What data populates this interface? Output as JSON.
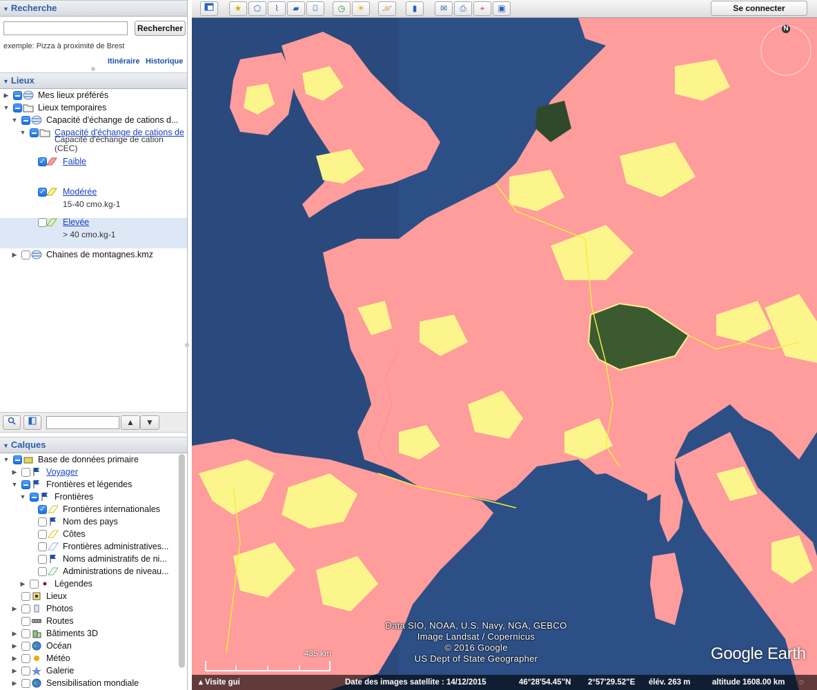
{
  "search": {
    "header": "Recherche",
    "placeholder": "",
    "button": "Rechercher",
    "example": "exemple: Pizza à proximité de Brest",
    "links": [
      "Itinéraire",
      "Historique"
    ]
  },
  "places": {
    "header": "Lieux",
    "items": [
      {
        "label": "Mes lieux préférés"
      },
      {
        "label": "Lieux temporaires"
      },
      {
        "label": "Capacité d'échange de cations d..."
      },
      {
        "label": "Capacité d'échange de cations de",
        "sub": "Capacité d'échange de cation (CEC)"
      },
      {
        "label": "Faible",
        "checked": true
      },
      {
        "label": "Modérée",
        "sub": "15-40 cmo.kg-1",
        "checked": true
      },
      {
        "label": "Elevée",
        "sub": "> 40 cmo.kg-1",
        "checked": false
      },
      {
        "label": "Chaines de montagnes.kmz"
      }
    ]
  },
  "layers": {
    "header": "Calques",
    "items": [
      {
        "label": "Base de données primaire"
      },
      {
        "label": "Voyager"
      },
      {
        "label": "Frontières et légendes"
      },
      {
        "label": "Frontières"
      },
      {
        "label": "Frontières internationales",
        "checked": true
      },
      {
        "label": "Nom des pays"
      },
      {
        "label": "Côtes"
      },
      {
        "label": "Frontières administratives..."
      },
      {
        "label": "Noms administratifs de ni..."
      },
      {
        "label": "Administrations de niveau..."
      },
      {
        "label": "Légendes"
      },
      {
        "label": "Lieux"
      },
      {
        "label": "Photos"
      },
      {
        "label": "Routes"
      },
      {
        "label": "Bâtiments 3D"
      },
      {
        "label": "Océan"
      },
      {
        "label": "Météo"
      },
      {
        "label": "Galerie"
      },
      {
        "label": "Sensibilisation mondiale"
      }
    ]
  },
  "toolbar": {
    "connect": "Se connecter"
  },
  "map": {
    "attribution": [
      "Data SIO, NOAA, U.S. Navy, NGA, GEBCO",
      "Image Landsat / Copernicus",
      "© 2016 Google",
      "US Dept of State Geographer"
    ],
    "logo": "Google Earth",
    "compass_n": "N",
    "scale": "435 km",
    "status": {
      "tour": "Visite gui",
      "imagery_date": "Date des images satellite : 14/12/2015",
      "lat": "46°28'54.45\"N",
      "lon": "2°57'29.52\"E",
      "elev": "élév.  263 m",
      "alt": "altitude 1608.00 km"
    },
    "colors": {
      "ocean": "#2c4f86",
      "low": "#ff9c9c",
      "moderate": "#fbf58c",
      "forest": "#3b5a30"
    }
  }
}
